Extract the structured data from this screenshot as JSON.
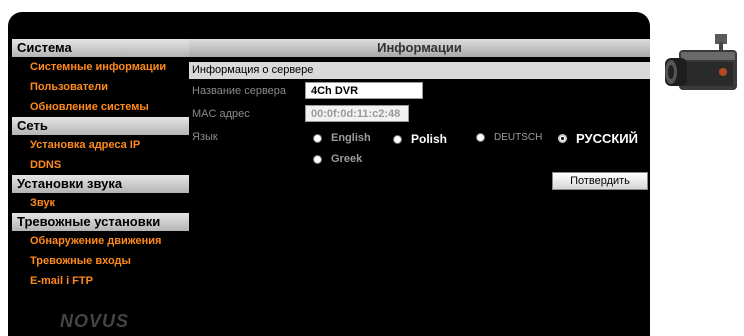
{
  "sidebar": {
    "sections": [
      {
        "title": "Система",
        "items": [
          "Системные информации",
          "Пользователи",
          "Обновление системы"
        ]
      },
      {
        "title": "Сеть",
        "items": [
          "Установка адреса IP",
          "DDNS"
        ]
      },
      {
        "title": "Установки звука",
        "items": [
          "Звук"
        ]
      },
      {
        "title": "Тревожные установки",
        "items": [
          "Обнаружение движения",
          "Тревожные входы",
          "E-mail i FTP"
        ]
      }
    ],
    "logo": "NOVUS"
  },
  "main": {
    "title": "Информации",
    "subtitle": "Информация о сервере",
    "server_name_label": "Название сервера",
    "server_name_value": "4Ch DVR",
    "mac_label": "MAC адрес",
    "mac_value": "00:0f:0d:11:c2:48",
    "language_label": "Язык",
    "languages": [
      "English",
      "Polish",
      "DEUTSCH",
      "РУССКИЙ",
      "Greek"
    ],
    "selected_language": "РУССКИЙ",
    "confirm_label": "Потвердить"
  },
  "colors": {
    "menu_item": "#ff8a1c",
    "background": "#000000"
  },
  "icons": {
    "camera": "security-camera-icon"
  }
}
